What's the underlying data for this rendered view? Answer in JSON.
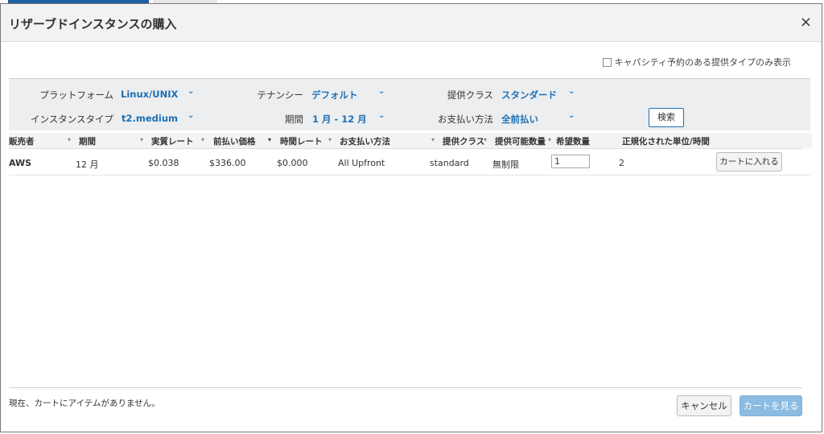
{
  "dialog": {
    "title": "リザーブドインスタンスの購入",
    "close_glyph": "×"
  },
  "capacity_option": {
    "label": "キャパシティ予約のある提供タイプのみ表示",
    "checked": false
  },
  "filters": {
    "platform": {
      "label": "プラットフォーム",
      "value": "Linux/UNIX"
    },
    "tenancy": {
      "label": "テナンシー",
      "value": "デフォルト"
    },
    "offering_class": {
      "label": "提供クラス",
      "value": "スタンダード"
    },
    "instance_type": {
      "label": "インスタンスタイプ",
      "value": "t2.medium"
    },
    "term": {
      "label": "期間",
      "value": "1 月 - 12 月"
    },
    "payment": {
      "label": "お支払い方法",
      "value": "全前払い"
    },
    "search_label": "検索",
    "chevron": "⌄"
  },
  "table": {
    "columns": [
      "販売者",
      "期間",
      "実質レート",
      "前払い価格",
      "時間レート",
      "お支払い方法",
      "提供クラス",
      "提供可能数量",
      "希望数量",
      "正規化された単位/時間"
    ],
    "rows": [
      {
        "seller": "AWS",
        "term": "12 月",
        "effective_rate": "$0.038",
        "upfront_price": "$336.00",
        "hourly_rate": "$0.000",
        "payment_option": "All Upfront",
        "offering_class": "standard",
        "available": "無制限",
        "desired_qty": "1",
        "normalized_units": "2",
        "add_to_cart_label": "カートに入れる"
      }
    ]
  },
  "footer": {
    "cart_status": "現在、カートにアイテムがありません。",
    "cancel_label": "キャンセル",
    "view_cart_label": "カートを見る"
  },
  "colors": {
    "accent": "#1f6fb5",
    "primary_button_disabled": "#8bbbe1"
  }
}
